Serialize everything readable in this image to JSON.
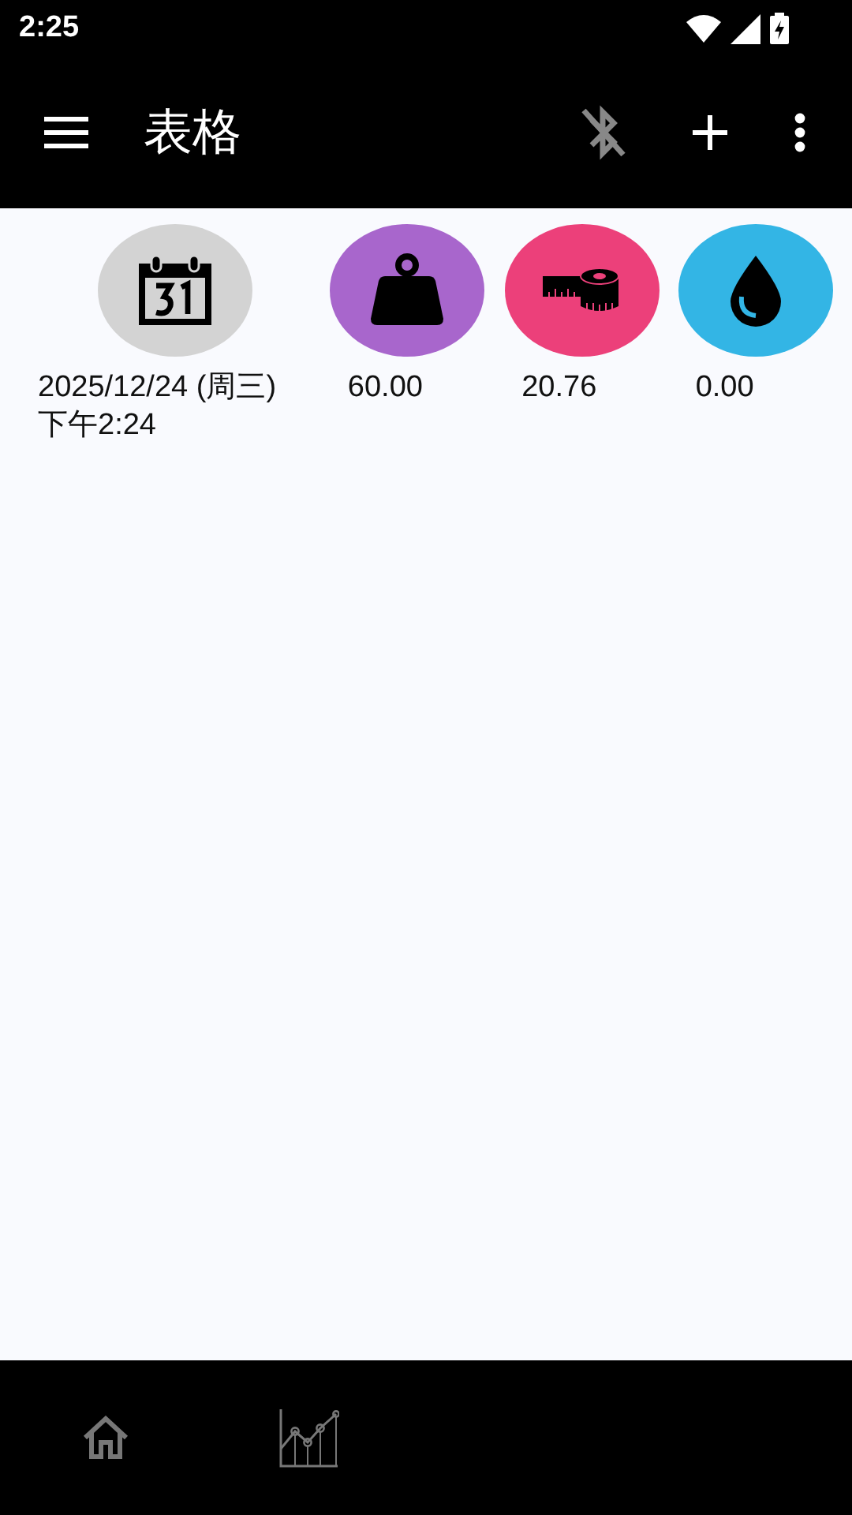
{
  "status_bar": {
    "time": "2:25"
  },
  "toolbar": {
    "title": "表格"
  },
  "columns": [
    {
      "kind": "date",
      "color": "#d3d3d3",
      "lines": [
        "2025/12/24 (周三)",
        "下午2:24"
      ]
    },
    {
      "kind": "weight",
      "color": "#a866cc",
      "lines": [
        "60.00"
      ]
    },
    {
      "kind": "tape",
      "color": "#ec407a",
      "lines": [
        "20.76"
      ]
    },
    {
      "kind": "drop",
      "color": "#33b5e5",
      "lines": [
        "0.00"
      ]
    }
  ]
}
